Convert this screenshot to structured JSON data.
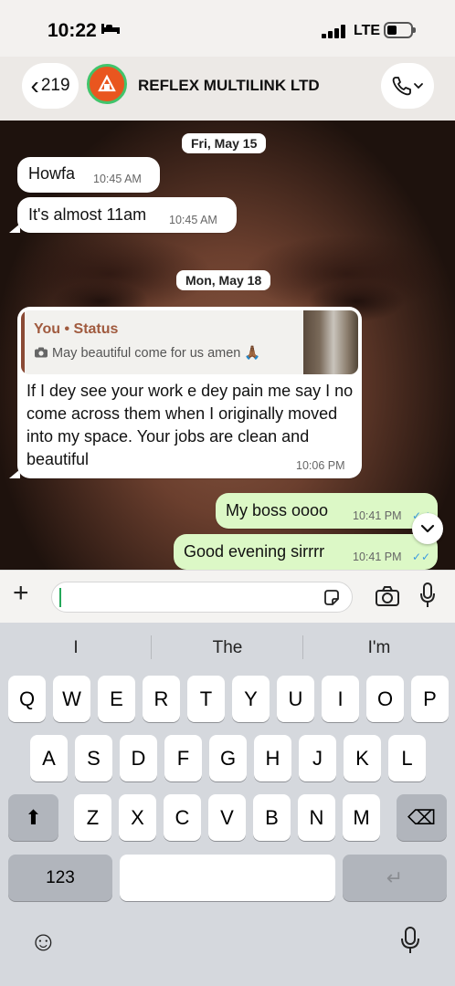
{
  "status_bar": {
    "time": "10:22",
    "network": "LTE"
  },
  "header": {
    "back_count": "219",
    "chat_name": "REFLEX MULTILINK LTD",
    "avatar_icon": "reflex-logo",
    "call_icon": "phone-icon"
  },
  "messages": {
    "date1": "Fri, May 15",
    "m1_text": "Howfa",
    "m1_time": "10:45 AM",
    "m2_text": "It's almost 11am",
    "m2_time": "10:45 AM",
    "date2": "Mon, May 18",
    "reply": {
      "author": "You • Status",
      "quoted_text": "May beautiful come for us amen 🙏🏾",
      "body": "If I dey see your work e dey pain me say I no come across them when I originally moved into my space. Your jobs are clean and beautiful",
      "time": "10:06 PM"
    },
    "m4_text": "My boss oooo",
    "m4_time": "10:41 PM",
    "m5_text": "Good evening sirrrr",
    "m5_time": "10:41 PM",
    "read_ticks": "✓✓"
  },
  "composer": {
    "value": "",
    "plus": "+"
  },
  "keyboard": {
    "suggestions": [
      "I",
      "The",
      "I'm"
    ],
    "row1": [
      "Q",
      "W",
      "E",
      "R",
      "T",
      "Y",
      "U",
      "I",
      "O",
      "P"
    ],
    "row2": [
      "A",
      "S",
      "D",
      "F",
      "G",
      "H",
      "J",
      "K",
      "L"
    ],
    "row3": [
      "Z",
      "X",
      "C",
      "V",
      "B",
      "N",
      "M"
    ],
    "numbers_key": "123",
    "shift_glyph": "⬆",
    "backspace_glyph": "⌫",
    "return_glyph": "↵",
    "emoji_glyph": "☺"
  },
  "colors": {
    "outgoing_bubble": "#dcf8c6",
    "incoming_bubble": "#ffffff",
    "read_tick": "#3a9ae0",
    "avatar_bg": "#e9561f"
  }
}
